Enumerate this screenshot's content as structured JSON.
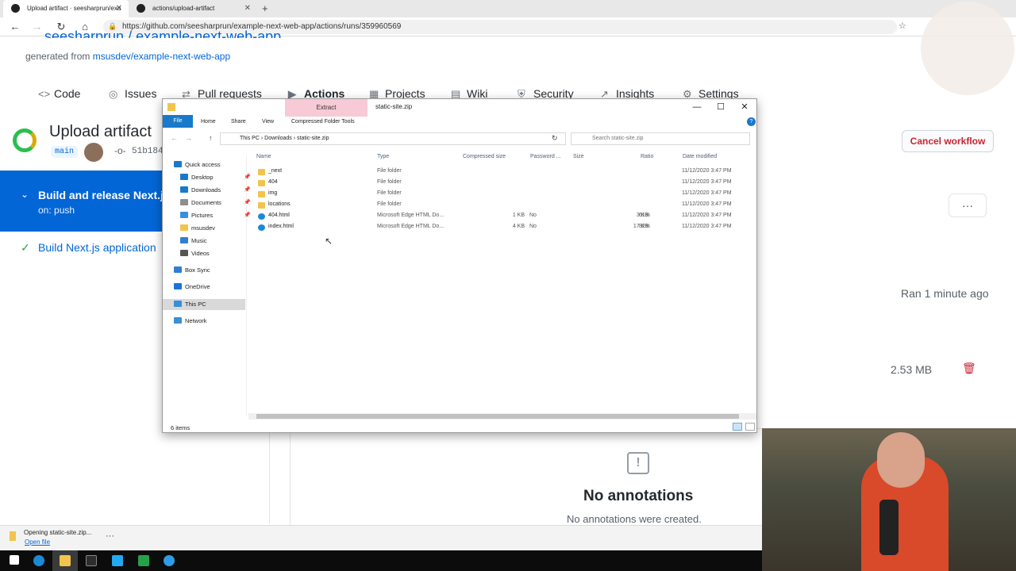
{
  "browser": {
    "tabs": [
      {
        "title": "Upload artifact · seesharprun/exa"
      },
      {
        "title": "actions/upload-artifact"
      }
    ],
    "new_tab": "+",
    "url": "https://github.com/seesharprun/example-next-web-app/actions/runs/359960569"
  },
  "github": {
    "repo_title": "seesharprun / example-next-web-app",
    "generated_from_label": "generated from",
    "generated_from_link": "msusdev/example-next-web-app",
    "repo_tabs": [
      {
        "label": "Code",
        "icon": "code-icon"
      },
      {
        "label": "Issues",
        "icon": "issue-icon"
      },
      {
        "label": "Pull requests",
        "icon": "pull-request-icon"
      },
      {
        "label": "Actions",
        "icon": "actions-icon"
      },
      {
        "label": "Projects",
        "icon": "projects-icon"
      },
      {
        "label": "Wiki",
        "icon": "wiki-icon"
      },
      {
        "label": "Security",
        "icon": "shield-icon"
      },
      {
        "label": "Insights",
        "icon": "graph-icon"
      },
      {
        "label": "Settings",
        "icon": "gear-icon"
      }
    ],
    "run_title": "Upload artifact",
    "branch": "main",
    "commit": "51b184",
    "job_title": "Build and release Next.js",
    "job_trigger": "on: push",
    "step_title": "Build Next.js application",
    "cancel_label": "Cancel workflow",
    "more_label": "···",
    "ran_label": "Ran 1 minute ago",
    "artifact_size": "2.53 MB",
    "no_annotations_title": "No annotations",
    "no_annotations_sub": "No annotations were created."
  },
  "explorer": {
    "ribbon_context_tab": "Extract",
    "ribbon_context_group": "Compressed Folder Tools",
    "window_title": "static-site.zip",
    "ribbon_tabs": [
      "File",
      "Home",
      "Share",
      "View"
    ],
    "breadcrumb": [
      "This PC",
      "Downloads",
      "static-site.zip"
    ],
    "search_placeholder": "Search static-site.zip",
    "nav": [
      {
        "label": "Quick access",
        "icon": "star-icon",
        "color": "#1979ca"
      },
      {
        "label": "Desktop",
        "icon": "desktop-icon",
        "color": "#1979ca",
        "pinned": true
      },
      {
        "label": "Downloads",
        "icon": "download-icon",
        "color": "#1979ca",
        "pinned": true
      },
      {
        "label": "Documents",
        "icon": "documents-icon",
        "color": "#8e8e8e",
        "pinned": true
      },
      {
        "label": "Pictures",
        "icon": "pictures-icon",
        "color": "#3a8fd6",
        "pinned": true
      },
      {
        "label": "msusdev",
        "icon": "folder-icon",
        "color": "#f3c44d"
      },
      {
        "label": "Music",
        "icon": "music-icon",
        "color": "#2f7fd2"
      },
      {
        "label": "Videos",
        "icon": "videos-icon",
        "color": "#555"
      },
      {
        "label": "Box Sync",
        "icon": "box-icon",
        "color": "#2f7fd2"
      },
      {
        "label": "OneDrive",
        "icon": "cloud-icon",
        "color": "#1e73d8"
      },
      {
        "label": "This PC",
        "icon": "computer-icon",
        "color": "#3a8fd6"
      },
      {
        "label": "Network",
        "icon": "network-icon",
        "color": "#3a8fd6"
      }
    ],
    "pin_glyph": "📌",
    "columns": [
      "Name",
      "Type",
      "Compressed size",
      "Password ...",
      "Size",
      "Ratio",
      "Date modified"
    ],
    "rows": [
      {
        "name": "_next",
        "type": "File folder",
        "compressed": "",
        "password": "",
        "size": "",
        "ratio": "",
        "date": "11/12/2020 3:47 PM",
        "icon": "folder-icon"
      },
      {
        "name": "404",
        "type": "File folder",
        "compressed": "",
        "password": "",
        "size": "",
        "ratio": "",
        "date": "11/12/2020 3:47 PM",
        "icon": "folder-icon"
      },
      {
        "name": "img",
        "type": "File folder",
        "compressed": "",
        "password": "",
        "size": "",
        "ratio": "",
        "date": "11/12/2020 3:47 PM",
        "icon": "folder-icon"
      },
      {
        "name": "locations",
        "type": "File folder",
        "compressed": "",
        "password": "",
        "size": "",
        "ratio": "",
        "date": "11/12/2020 3:47 PM",
        "icon": "folder-icon"
      },
      {
        "name": "404.html",
        "type": "Microsoft Edge HTML Do...",
        "compressed": "1 KB",
        "password": "No",
        "size": "3 KB",
        "ratio": "61%",
        "date": "11/12/2020 3:47 PM",
        "icon": "edge-icon"
      },
      {
        "name": "index.html",
        "type": "Microsoft Edge HTML Do...",
        "compressed": "4 KB",
        "password": "No",
        "size": "17 KB",
        "ratio": "82%",
        "date": "11/12/2020 3:47 PM",
        "icon": "edge-icon"
      }
    ],
    "status": "6 items"
  },
  "download_bar": {
    "text": "Opening static-site.zip...",
    "link": "Open file",
    "more": "···"
  },
  "colors": {
    "accent": "#0366d6",
    "success": "#2cbe4e",
    "danger": "#cb2431",
    "ribbon_file": "#1979ca",
    "extract_tab": "#f8c9d7"
  }
}
